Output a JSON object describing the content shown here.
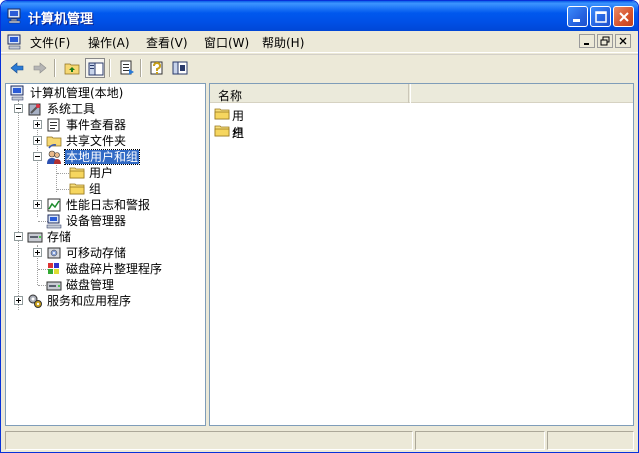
{
  "window": {
    "title": "计算机管理"
  },
  "menu": {
    "items": [
      {
        "label": "文件(F)"
      },
      {
        "label": "操作(A)"
      },
      {
        "label": "查看(V)"
      },
      {
        "label": "窗口(W)"
      },
      {
        "label": "帮助(H)"
      }
    ]
  },
  "toolbar": {
    "buttons": [
      "back-icon",
      "forward-icon",
      "up-folder-icon",
      "show-hide-tree-icon",
      "export-list-icon",
      "help-icon",
      "properties-icon"
    ]
  },
  "tree": {
    "root": "计算机管理(本地)",
    "system_tools": "系统工具",
    "event_viewer": "事件查看器",
    "shared_folders": "共享文件夹",
    "local_users_groups": "本地用户和组",
    "users": "用户",
    "groups": "组",
    "perf_logs": "性能日志和警报",
    "device_manager": "设备管理器",
    "storage": "存储",
    "removable_storage": "可移动存储",
    "defrag": "磁盘碎片整理程序",
    "disk_mgmt": "磁盘管理",
    "services_apps": "服务和应用程序"
  },
  "list": {
    "column_name": "名称",
    "items": [
      {
        "label": "用户"
      },
      {
        "label": "组"
      }
    ]
  },
  "colors": {
    "title_bar": "#0058ee",
    "selection": "#316ac5",
    "chrome": "#ece9d8"
  }
}
